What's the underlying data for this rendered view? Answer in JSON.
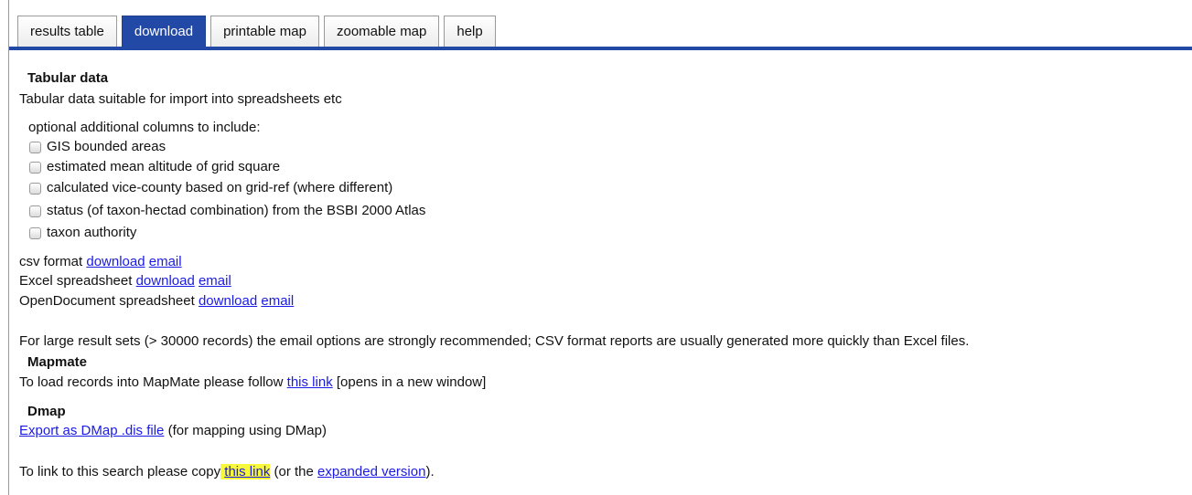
{
  "tabs": [
    {
      "label": "results table",
      "active": false
    },
    {
      "label": "download",
      "active": true
    },
    {
      "label": "printable map",
      "active": false
    },
    {
      "label": "zoomable map",
      "active": false
    },
    {
      "label": "help",
      "active": false
    }
  ],
  "tabular": {
    "heading": "Tabular data",
    "description": "Tabular data suitable for import into spreadsheets etc",
    "optional_label": "optional additional columns to include:",
    "options": [
      "GIS bounded areas",
      "estimated mean altitude of grid square",
      "calculated vice-county based on grid-ref (where different)",
      "status (of taxon-hectad combination) from the BSBI 2000 Atlas",
      "taxon authority"
    ],
    "formats": [
      {
        "label": "csv format",
        "download": "download",
        "email": "email"
      },
      {
        "label": "Excel spreadsheet",
        "download": "download",
        "email": "email"
      },
      {
        "label": "OpenDocument spreadsheet",
        "download": "download",
        "email": "email"
      }
    ],
    "note": "For large result sets (> 30000 records) the email options are strongly recommended; CSV format reports are usually generated more quickly than Excel files."
  },
  "mapmate": {
    "heading": "Mapmate",
    "text_before": "To load records into MapMate please follow",
    "link": "this link",
    "text_after": "[opens in a new window]"
  },
  "dmap": {
    "heading": "Dmap",
    "link": "Export as DMap .dis file",
    "text_after": "(for mapping using DMap)"
  },
  "search_link": {
    "text_before": "To link to this search please copy",
    "link": "this link",
    "text_middle": "(or the",
    "link2": "expanded version",
    "text_after": ")."
  },
  "colors": {
    "accent": "#2249a6",
    "link": "#1a1ae6",
    "highlight": "#f8f83a"
  }
}
